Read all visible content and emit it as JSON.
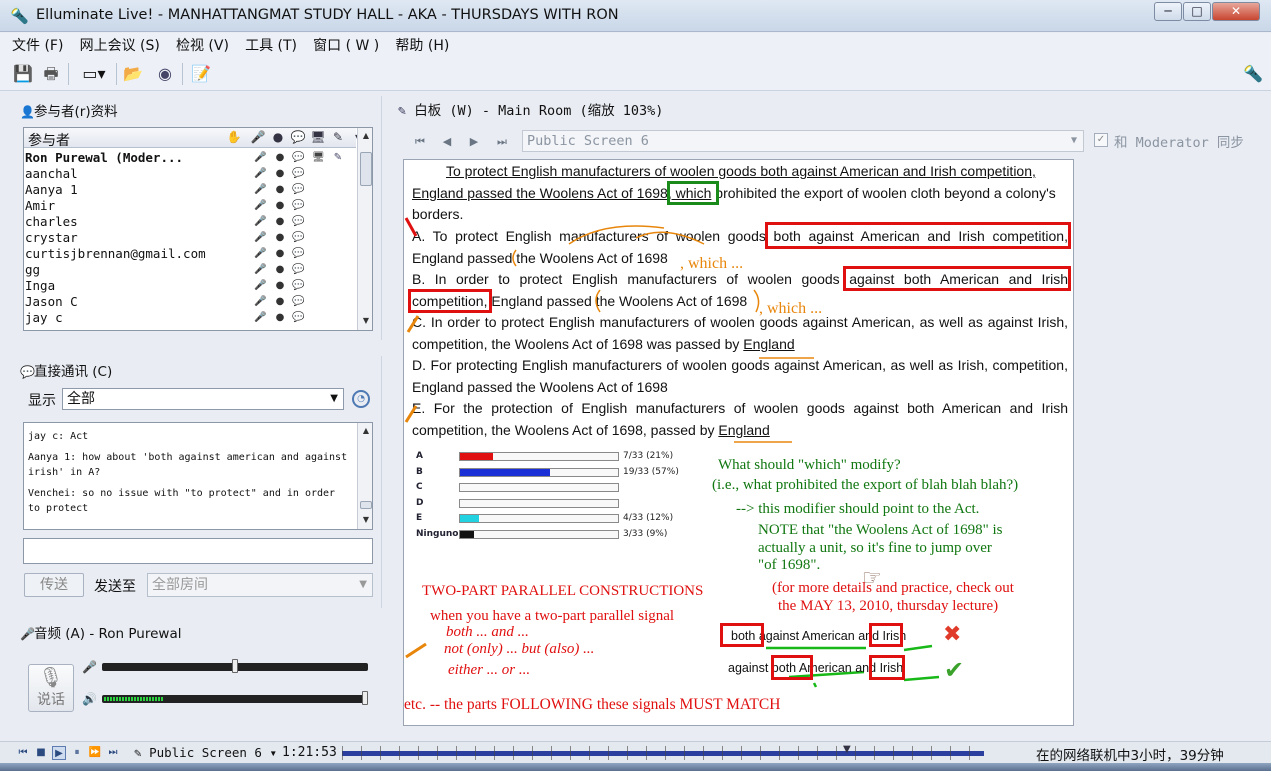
{
  "window": {
    "title": "Elluminate Live! - MANHATTANGMAT STUDY HALL - AKA - THURSDAYS WITH RON",
    "minimize": "─",
    "maximize": "□",
    "close": "✕"
  },
  "menu": [
    "文件 (F)",
    "网上会议 (S)",
    "检视 (V)",
    "工具 (T)",
    "窗口 ( W )",
    "帮助 (H)"
  ],
  "participants": {
    "title": "参与者(r)资料",
    "header": "参与者",
    "rows": [
      {
        "name": "Ron Purewal (Moder..."
      },
      {
        "name": "aanchal"
      },
      {
        "name": "Aanya 1"
      },
      {
        "name": "Amir"
      },
      {
        "name": "charles"
      },
      {
        "name": "crystar"
      },
      {
        "name": "curtisjbrennan@gmail.com"
      },
      {
        "name": "gg"
      },
      {
        "name": "Inga"
      },
      {
        "name": "Jason C"
      },
      {
        "name": "jay c"
      }
    ]
  },
  "chat": {
    "title": "直接通讯 (C)",
    "show_label": "显示",
    "show_value": "全部",
    "messages": [
      "jay c: Act",
      "Aanya 1: how about 'both against american and against irish' in A?",
      "Venchei: so no issue with \"to protect\" and in order to protect"
    ],
    "send_button": "传送",
    "send_to_label": "发送至",
    "send_to_value": "全部房间"
  },
  "audio": {
    "title": "音频 (A) - Ron Purewal",
    "talk_label": "说话",
    "mic_level": 0.5,
    "speaker_level": 0.23
  },
  "whiteboard": {
    "title": "白板 (W) - Main Room (缩放 103%)",
    "screen": "Public Screen 6",
    "sync_label": "和 Moderator 同步",
    "sync_checked": true,
    "q1": "To protect English manufacturers of woolen goods both against American and Irish competition,",
    "q2a": "England passed the Woolens Act of 1698",
    "q2b": ", which",
    "q2c": " prohibited the export of woolen cloth beyond a colony's",
    "q3": "borders.",
    "a1": "A. To protect English manufacturers of woolen goods both against American and Irish competition,",
    "a2": "England passed the Woolens Act of 1698",
    "b1": "B. In order to protect English manufacturers of woolen goods against both American and Irish",
    "b2": "competition, England passed the Woolens Act of 1698",
    "c1": "C. In order to protect English manufacturers of woolen goods against American, as well as against Irish,",
    "c2a": "competition, the Woolens Act of 1698 was passed by ",
    "c2b": "England",
    "d1": "D. For protecting English manufacturers of woolen goods against American, as well as Irish, competition,",
    "d2": "England passed the Woolens Act of 1698",
    "e1": "E. For the protection of English manufacturers of woolen goods against both American and Irish",
    "e2a": "competition, the Woolens Act of 1698, passed by ",
    "e2b": "England",
    "which1": ", which ...",
    "which2": ", which ...",
    "poll": [
      {
        "label": "A",
        "count": "7/33 (21%)",
        "pct": 21,
        "color": "#e01010"
      },
      {
        "label": "B",
        "count": "19/33 (57%)",
        "pct": 57,
        "color": "#1a2fd6"
      },
      {
        "label": "C",
        "count": "",
        "pct": 0,
        "color": "#888"
      },
      {
        "label": "D",
        "count": "",
        "pct": 0,
        "color": "#888"
      },
      {
        "label": "E",
        "count": "4/33 (12%)",
        "pct": 12,
        "color": "#23d2e0"
      },
      {
        "label": "Ninguno",
        "count": "3/33 (9%)",
        "pct": 9,
        "color": "#111"
      }
    ],
    "note1": "What should \"which\" modify?",
    "note2": "(i.e., what prohibited the export of blah blah blah?)",
    "note3": "--> this modifier should point to the Act.",
    "note4": "NOTE that \"the Woolens Act of 1698\" is",
    "note5": "actually a unit, so it's fine to jump over",
    "note6": "\"of 1698\".",
    "two_part": "TWO-PART PARALLEL CONSTRUCTIONS",
    "more1": "(for more details and practice, check out",
    "more2": "the MAY 13, 2010, thursday lecture)",
    "signal": "when you have a two-part parallel signal",
    "ex1": "both ... and ...",
    "ex2": "not (only) ... but (also) ...",
    "ex3": "either ... or ...",
    "bottom": "etc. -- the parts FOLLOWING these signals MUST MATCH",
    "wrong": {
      "w1": "both",
      "w2": "against American",
      "w3": "and",
      "w4": "Irish"
    },
    "right": {
      "w1": "against",
      "w2": "both",
      "w3": "American",
      "w4": "and",
      "w5": "Irish"
    }
  },
  "playback": {
    "screen": "Public Screen 6",
    "time": "1:21:53",
    "status": "在的网络联机中3小时，39分钟"
  }
}
